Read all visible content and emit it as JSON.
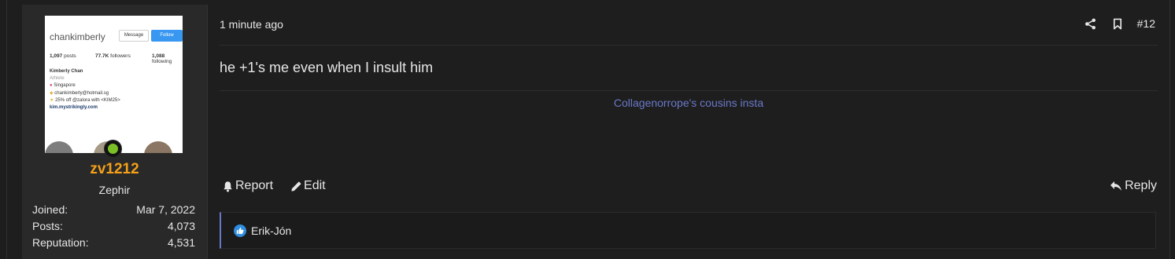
{
  "user": {
    "avatar": {
      "ig_handle": "chankimberly",
      "message_label": "Message",
      "follow_label": "Follow",
      "stats": [
        {
          "value": "1,097",
          "label": "posts"
        },
        {
          "value": "77.7K",
          "label": "followers"
        },
        {
          "value": "1,088",
          "label": "following"
        }
      ],
      "name": "Kimberly Chan",
      "category": "Athlete",
      "location": "Singapore",
      "email": "chankimberly@hotmail.sg",
      "promo": "25% off @zalora with <KIM25>",
      "link": "kim.mystrikingly.com"
    },
    "username": "zv1212",
    "title": "Zephir",
    "stats": [
      {
        "label": "Joined:",
        "value": "Mar 7, 2022"
      },
      {
        "label": "Posts:",
        "value": "4,073"
      },
      {
        "label": "Reputation:",
        "value": "4,531"
      }
    ],
    "username_color": "#f4a018",
    "online_color": "#7cc028"
  },
  "post": {
    "time": "1 minute ago",
    "number": "#12",
    "body": "he +1's me even when I insult him",
    "signature": "Collagenorrope's cousins insta",
    "actions": {
      "report": "Report",
      "edit": "Edit",
      "reply": "Reply"
    },
    "reactions": {
      "user": "Erik-Jón",
      "type": "like-icon"
    },
    "accent_color": "#6a78c8"
  }
}
